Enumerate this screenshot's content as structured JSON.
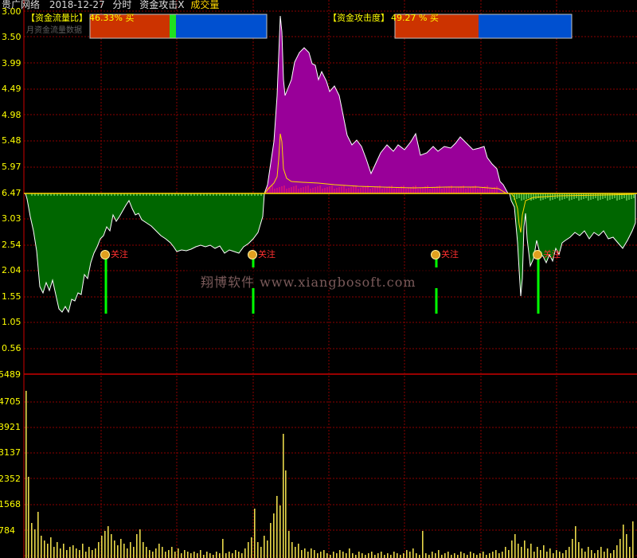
{
  "title": {
    "stock_name": "贵广网络",
    "date": "2018-12-27",
    "period": "分时",
    "indicator": "资金攻击X",
    "volume_label": "成交量"
  },
  "legend_left": {
    "label": "【资金流量比】",
    "value": "46.33% 买"
  },
  "legend_right": {
    "label": "【资金攻击度】",
    "value": "49.27 % 买"
  },
  "sub_legend": "月资金流量数据",
  "upper_axis_labels": [
    "3.00",
    "3.50",
    "3.99",
    "4.49",
    "4.98",
    "5.48",
    "5.97",
    "6.47",
    "3.03",
    "2.54",
    "2.04",
    "1.55",
    "1.05",
    "0.56"
  ],
  "volume_axis_labels": [
    "5489",
    "4705",
    "3921",
    "3137",
    "2352",
    "1568",
    "784"
  ],
  "watermark": "翔博软件 www.xiangbosoft.com",
  "markers": [
    {
      "label": "关注"
    },
    {
      "label": "关注"
    },
    {
      "label": "关注"
    },
    {
      "label": "关注"
    }
  ],
  "colors": {
    "background": "#000000",
    "grid": "#8b0000",
    "axis_text": "#ffff00",
    "buy_area": "#990099",
    "sell_area": "#006600",
    "buy_bar": "#cc3300",
    "sell_bar": "#0050d0",
    "signal": "#00ff00",
    "volume": "#e8d84a"
  }
}
